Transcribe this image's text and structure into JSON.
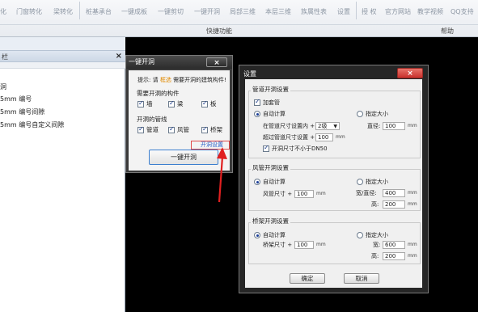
{
  "ribbon": {
    "items": [
      "化",
      "门窗转化",
      "梁转化",
      "桩基承台",
      "一键成板",
      "一键剪切",
      "一键开洞",
      "局部三维",
      "本层三维",
      "族属性表",
      "设置",
      "授 权",
      "官方网站",
      "教学视频",
      "QQ支持"
    ],
    "groups": [
      "快捷功能",
      "帮助"
    ]
  },
  "left_panel": {
    "title": "栏",
    "close": "×",
    "rows": [
      "洞",
      "5mm 编号",
      "5mm 编号间隙",
      "5mm 编号自定义间隙"
    ]
  },
  "quick_dialog": {
    "title": "一键开洞",
    "close": "×",
    "hint_prefix": "提示: 请",
    "hint_highlight": "框选",
    "hint_suffix": "需要开洞的建筑构件!",
    "components_label": "需要开洞的构件",
    "components": [
      "墙",
      "梁",
      "板"
    ],
    "pipes_label": "开洞的管线",
    "pipes": [
      "管道",
      "风管",
      "桥架"
    ],
    "settings_link": "开洞设置",
    "action_button": "一键开洞"
  },
  "settings_dialog": {
    "title": "设置",
    "close": "×",
    "pipe_section": {
      "title": "管道开洞设置",
      "casing_label": "加套管",
      "auto_label": "自动计算",
      "fixed_label": "指定大小",
      "size_within_label": "在管道尺寸设置内 +",
      "size_within_value": "2级",
      "size_beyond_label": "超过管道尺寸设置 +",
      "size_beyond_value": "100",
      "min_label": "开洞尺寸不小于DN50",
      "diameter_label": "直径:",
      "diameter_value": "100",
      "unit": "mm"
    },
    "duct_section": {
      "title": "风管开洞设置",
      "auto_label": "自动计算",
      "fixed_label": "指定大小",
      "size_label": "风管尺寸 +",
      "size_value": "100",
      "width_label": "宽/直径:",
      "width_value": "400",
      "height_label": "高:",
      "height_value": "200",
      "unit": "mm"
    },
    "tray_section": {
      "title": "桥架开洞设置",
      "auto_label": "自动计算",
      "fixed_label": "指定大小",
      "size_label": "桥架尺寸 +",
      "size_value": "100",
      "width_label": "宽:",
      "width_value": "600",
      "height_label": "高:",
      "height_value": "200",
      "unit": "mm"
    },
    "ok_button": "确定",
    "cancel_button": "取消"
  },
  "colors": {
    "accent_highlight": "#e08a00",
    "link_blue": "#2a60c8",
    "annotation_red": "#e02020",
    "close_red": "#c9302c"
  }
}
